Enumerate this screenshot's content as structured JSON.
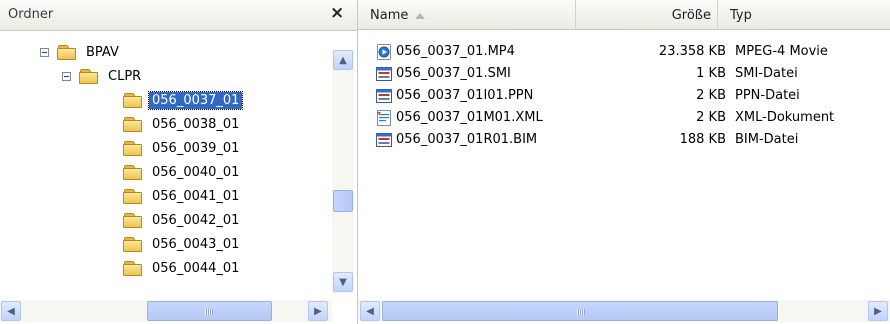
{
  "folder_pane": {
    "title": "Ordner",
    "close_glyph": "×",
    "tree": [
      {
        "label": "BPAV",
        "expanded": true
      },
      {
        "label": "CLPR",
        "expanded": true
      },
      {
        "label": "056_0037_01",
        "selected": true
      },
      {
        "label": "056_0038_01"
      },
      {
        "label": "056_0039_01"
      },
      {
        "label": "056_0040_01"
      },
      {
        "label": "056_0041_01"
      },
      {
        "label": "056_0042_01"
      },
      {
        "label": "056_0043_01"
      },
      {
        "label": "056_0044_01"
      }
    ]
  },
  "file_list": {
    "columns": {
      "name": "Name",
      "size": "Größe",
      "type": "Typ"
    },
    "sort_column": "name",
    "files": [
      {
        "name": "056_0037_01.MP4",
        "size": "23.358 KB",
        "type": "MPEG-4 Movie",
        "icon": "mp4-file-icon"
      },
      {
        "name": "056_0037_01.SMI",
        "size": "1 KB",
        "type": "SMI-Datei",
        "icon": "smi-file-icon"
      },
      {
        "name": "056_0037_01I01.PPN",
        "size": "2 KB",
        "type": "PPN-Datei",
        "icon": "ppn-file-icon"
      },
      {
        "name": "056_0037_01M01.XML",
        "size": "2 KB",
        "type": "XML-Dokument",
        "icon": "xml-file-icon"
      },
      {
        "name": "056_0037_01R01.BIM",
        "size": "188 KB",
        "type": "BIM-Datei",
        "icon": "bim-file-icon"
      }
    ]
  },
  "colors": {
    "selection": "#316ac5",
    "folder": "#eec24e",
    "scrollbar": "#c1d3fb"
  }
}
